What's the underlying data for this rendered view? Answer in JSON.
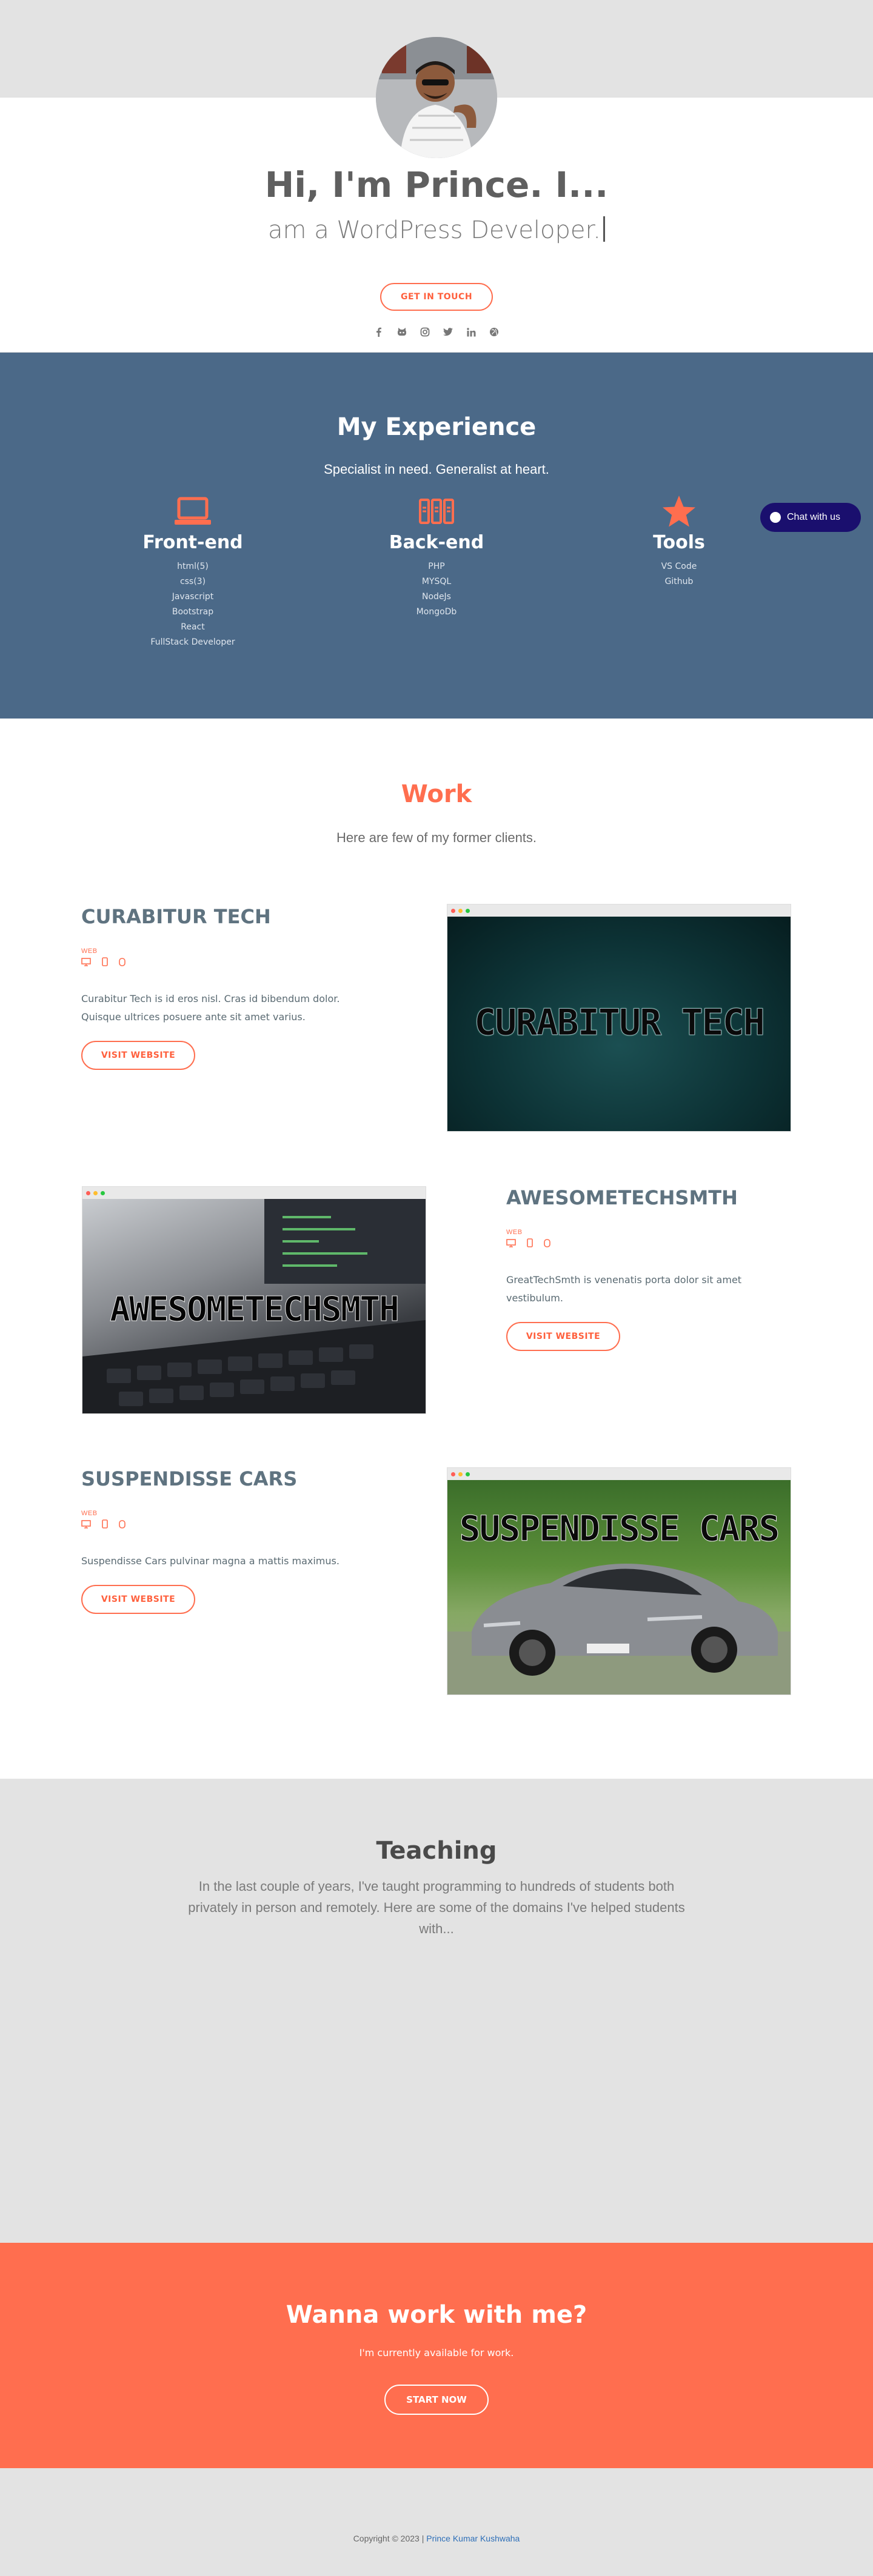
{
  "hero": {
    "title": "Hi, I'm Prince. I...",
    "subtitle": "am a WordPress Developer.",
    "cta_label": "GET IN TOUCH",
    "social_icons": [
      "facebook-icon",
      "github-icon",
      "instagram-icon",
      "twitter-icon",
      "linkedin-icon",
      "globe-icon"
    ]
  },
  "experience": {
    "title": "My Experience",
    "subtitle": "Specialist in need. Generalist at heart.",
    "columns": [
      {
        "icon": "laptop-icon",
        "title": "Front-end",
        "items": [
          "html(5)",
          "css(3)",
          "Javascript",
          "Bootstrap",
          "React",
          "FullStack Developer"
        ]
      },
      {
        "icon": "server-icon",
        "title": "Back-end",
        "items": [
          "PHP",
          "MYSQL",
          "NodeJs",
          "MongoDb"
        ]
      },
      {
        "icon": "star-icon",
        "title": "Tools",
        "items": [
          "VS Code",
          "Github"
        ]
      }
    ]
  },
  "chat": {
    "label": "Chat with us"
  },
  "work": {
    "title": "Work",
    "subtitle": "Here are few of my former clients.",
    "projects": [
      {
        "title": "CURABITUR TECH",
        "tag": "WEB",
        "icons": [
          "desktop-icon",
          "mobile-icon",
          "tablet-icon"
        ],
        "description": "Curabitur Tech is id eros nisl. Cras id bibendum dolor. Quisque ultrices posuere ante sit amet varius.",
        "button": "VISIT WEBSITE",
        "screen_text": "CURABITUR TECH"
      },
      {
        "title": "AWESOMETECHSMTH",
        "tag": "WEB",
        "icons": [
          "desktop-icon",
          "mobile-icon",
          "tablet-icon"
        ],
        "description": "GreatTechSmth is venenatis porta dolor sit amet vestibulum.",
        "button": "VISIT WEBSITE",
        "screen_text": "AWESOMETECHSMTH"
      },
      {
        "title": "SUSPENDISSE CARS",
        "tag": "WEB",
        "icons": [
          "desktop-icon",
          "mobile-icon",
          "tablet-icon"
        ],
        "description": "Suspendisse Cars pulvinar magna a mattis maximus.",
        "button": "VISIT WEBSITE",
        "screen_text": "SUSPENDISSE CARS"
      }
    ]
  },
  "teaching": {
    "title": "Teaching",
    "text": "In the last couple of years, I've taught programming to hundreds of students both privately in person and remotely. Here are some of the domains I've helped students with..."
  },
  "cta": {
    "title": "Wanna work with me?",
    "subtitle": "I'm currently available for work.",
    "button": "START NOW"
  },
  "footer": {
    "copyright": "Copyright © 2023 |",
    "author": "Prince Kumar Kushwaha"
  },
  "colors": {
    "accent": "#ff6e4f",
    "experience_bg": "#4b6988",
    "chat_bg": "#1a0f6e",
    "page_bg": "#e3e3e3"
  }
}
